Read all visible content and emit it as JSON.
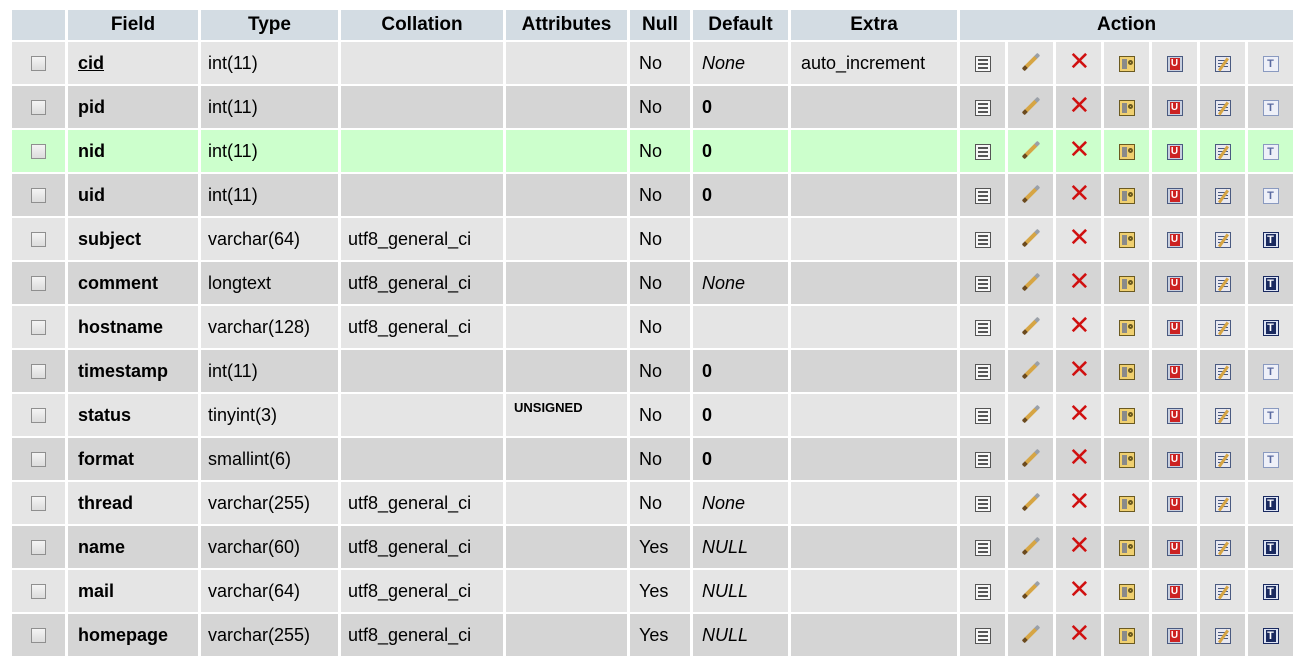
{
  "headers": {
    "field": "Field",
    "type": "Type",
    "collation": "Collation",
    "attributes": "Attributes",
    "null": "Null",
    "default": "Default",
    "extra": "Extra",
    "action": "Action"
  },
  "action_icons": [
    "browse-icon",
    "edit-icon",
    "drop-icon",
    "primary-key-icon",
    "unique-icon",
    "index-icon",
    "fulltext-icon"
  ],
  "colors": {
    "header_bg": "#d3dce3",
    "row_odd": "#e5e5e5",
    "row_even": "#d5d5d5",
    "row_highlight": "#ccffcc",
    "drop_icon": "#d01010"
  },
  "rows": [
    {
      "field": "cid",
      "type": "int(11)",
      "collation": "",
      "attributes": "",
      "null": "No",
      "default": "None",
      "extra": "auto_increment"
    },
    {
      "field": "pid",
      "type": "int(11)",
      "collation": "",
      "attributes": "",
      "null": "No",
      "default": "0",
      "extra": ""
    },
    {
      "field": "nid",
      "type": "int(11)",
      "collation": "",
      "attributes": "",
      "null": "No",
      "default": "0",
      "extra": ""
    },
    {
      "field": "uid",
      "type": "int(11)",
      "collation": "",
      "attributes": "",
      "null": "No",
      "default": "0",
      "extra": ""
    },
    {
      "field": "subject",
      "type": "varchar(64)",
      "collation": "utf8_general_ci",
      "attributes": "",
      "null": "No",
      "default": "",
      "extra": ""
    },
    {
      "field": "comment",
      "type": "longtext",
      "collation": "utf8_general_ci",
      "attributes": "",
      "null": "No",
      "default": "None",
      "extra": ""
    },
    {
      "field": "hostname",
      "type": "varchar(128)",
      "collation": "utf8_general_ci",
      "attributes": "",
      "null": "No",
      "default": "",
      "extra": ""
    },
    {
      "field": "timestamp",
      "type": "int(11)",
      "collation": "",
      "attributes": "",
      "null": "No",
      "default": "0",
      "extra": ""
    },
    {
      "field": "status",
      "type": "tinyint(3)",
      "collation": "",
      "attributes": "UNSIGNED",
      "null": "No",
      "default": "0",
      "extra": ""
    },
    {
      "field": "format",
      "type": "smallint(6)",
      "collation": "",
      "attributes": "",
      "null": "No",
      "default": "0",
      "extra": ""
    },
    {
      "field": "thread",
      "type": "varchar(255)",
      "collation": "utf8_general_ci",
      "attributes": "",
      "null": "No",
      "default": "None",
      "extra": ""
    },
    {
      "field": "name",
      "type": "varchar(60)",
      "collation": "utf8_general_ci",
      "attributes": "",
      "null": "Yes",
      "default": "NULL",
      "extra": ""
    },
    {
      "field": "mail",
      "type": "varchar(64)",
      "collation": "utf8_general_ci",
      "attributes": "",
      "null": "Yes",
      "default": "NULL",
      "extra": ""
    },
    {
      "field": "homepage",
      "type": "varchar(255)",
      "collation": "utf8_general_ci",
      "attributes": "",
      "null": "Yes",
      "default": "NULL",
      "extra": ""
    }
  ]
}
